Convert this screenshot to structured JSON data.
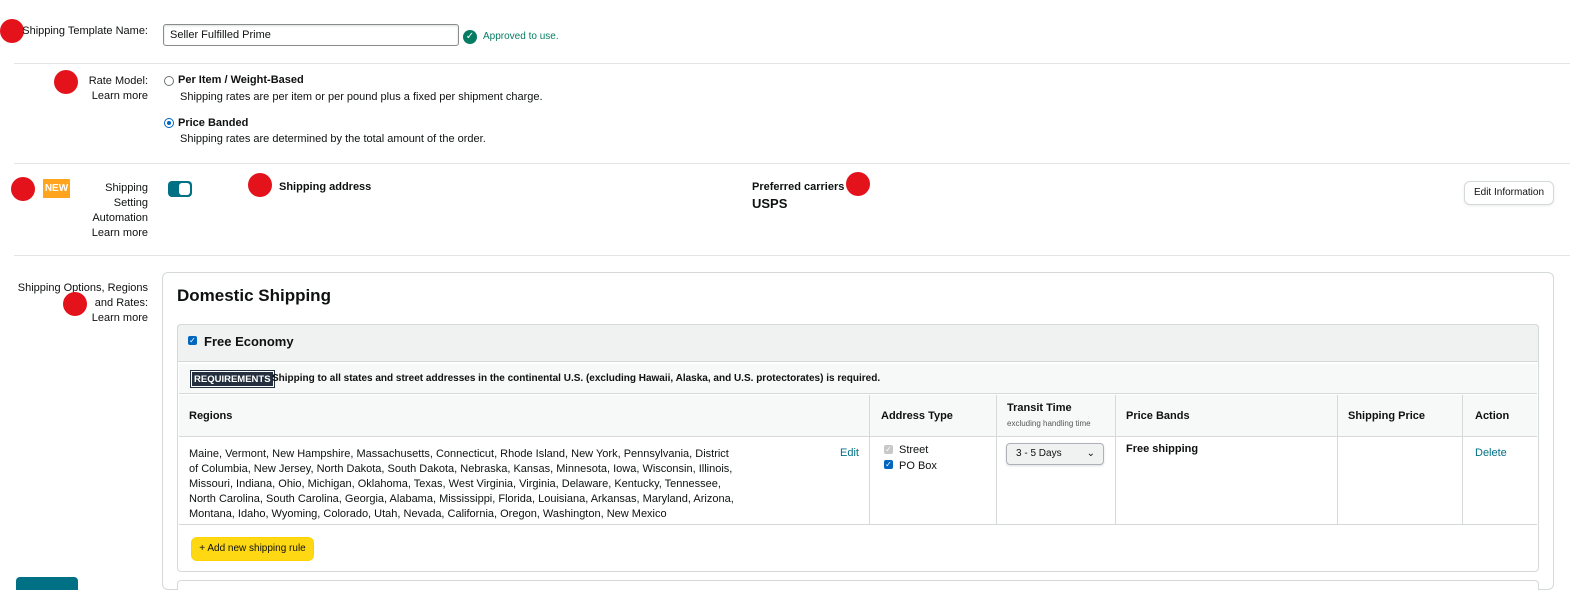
{
  "template": {
    "label": "Shipping Template Name:",
    "value": "Seller Fulfilled Prime",
    "status": "Approved to use."
  },
  "rate_model": {
    "label": "Rate Model:",
    "learn_more": "Learn more",
    "options": [
      {
        "title": "Per Item / Weight-Based",
        "desc": "Shipping rates are per item or per pound plus a fixed per shipment charge.",
        "selected": false
      },
      {
        "title": "Price Banded",
        "desc": "Shipping rates are determined by the total amount of the order.",
        "selected": true
      }
    ]
  },
  "automation": {
    "badge": "NEW",
    "label_line1": "Shipping",
    "label_line2": "Setting",
    "label_line3": "Automation",
    "learn_more": "Learn more",
    "toggle_on": true,
    "shipping_address_label": "Shipping address",
    "preferred_carriers_label": "Preferred carriers",
    "carrier": "USPS",
    "edit_button": "Edit Information"
  },
  "options": {
    "label_line1": "Shipping Options, Regions",
    "label_line2": "and Rates:",
    "learn_more": "Learn more",
    "section_title": "Domestic Shipping",
    "method": {
      "title": "Free Economy",
      "checked": true,
      "requirements_badge": "REQUIREMENTS",
      "requirements_text": "Shipping to all states and street addresses in the continental U.S. (excluding Hawaii, Alaska, and U.S. protectorates) is required."
    },
    "table": {
      "headers": {
        "regions": "Regions",
        "address_type": "Address Type",
        "transit_time": "Transit Time",
        "transit_sub": "excluding handling time",
        "price_bands": "Price Bands",
        "shipping_price": "Shipping Price",
        "action": "Action"
      },
      "row": {
        "regions": "Maine, Vermont, New Hampshire, Massachusetts, Connecticut, Rhode Island, New York, Pennsylvania, District of Columbia, New Jersey, North Dakota, South Dakota, Nebraska, Kansas, Minnesota, Iowa, Wisconsin, Illinois, Missouri, Indiana, Ohio, Michigan, Oklahoma, Texas, West Virginia, Virginia, Delaware, Kentucky, Tennessee, North Carolina, South Carolina, Georgia, Alabama, Mississippi, Florida, Louisiana, Arkansas, Maryland, Arizona, Montana, Idaho, Wyoming, Colorado, Utah, Nevada, California, Oregon, Washington, New Mexico",
        "edit": "Edit",
        "address_street": "Street",
        "address_pobox": "PO Box",
        "transit": "3 - 5 Days",
        "price_band": "Free shipping",
        "shipping_price": "",
        "action": "Delete"
      }
    },
    "add_rule": "+ Add new shipping rule"
  },
  "colors": {
    "link": "#007185",
    "approved": "#067d62",
    "badge_new": "#ffa41c",
    "primary_button": "#ffd814",
    "marker": "#e3121b"
  }
}
